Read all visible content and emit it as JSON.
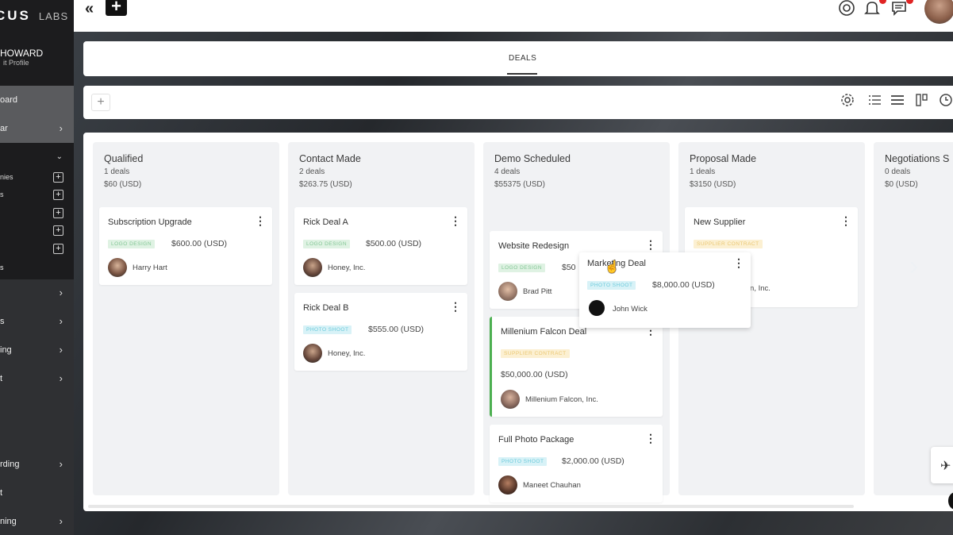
{
  "brand": {
    "logo_text": "CUS",
    "logo_suffix": "LABS"
  },
  "user": {
    "name": "HOWARD",
    "edit_link": "it Profile"
  },
  "sidebar": {
    "items": [
      {
        "label": "oard",
        "chevron": false
      },
      {
        "label": "ar",
        "chevron": true
      },
      {
        "label": "",
        "chevron": true
      },
      {
        "label": "s",
        "chevron": false
      },
      {
        "label": "",
        "chevron": true
      },
      {
        "label": "s",
        "chevron": true
      },
      {
        "label": "ing",
        "chevron": true
      },
      {
        "label": "t",
        "chevron": true
      },
      {
        "label": "rding",
        "chevron": true
      },
      {
        "label": "t",
        "chevron": false
      },
      {
        "label": "ning",
        "chevron": true
      }
    ],
    "subitems": [
      "nies",
      "s",
      "",
      "",
      ""
    ]
  },
  "topbar": {
    "collapse_glyph": "«",
    "add_glyph": "+",
    "icons": [
      "support-icon",
      "bell-icon",
      "chat-icon"
    ]
  },
  "tabs": [
    {
      "label": "DEALS",
      "active": true
    }
  ],
  "toolbar": {
    "add_glyph": "+"
  },
  "columns": [
    {
      "title": "Qualified",
      "count": "1 deals",
      "total": "$60 (USD)",
      "cards": [
        {
          "title": "Subscription Upgrade",
          "tag": "LOGO DESIGN",
          "tag_type": "logo",
          "amount": "$600.00 (USD)",
          "company": "Harry Hart"
        }
      ]
    },
    {
      "title": "Contact Made",
      "count": "2 deals",
      "total": "$263.75 (USD)",
      "cards": [
        {
          "title": "Rick Deal A",
          "tag": "LOGO DESIGN",
          "tag_type": "logo",
          "amount": "$500.00 (USD)",
          "company": "Honey, Inc."
        },
        {
          "title": "Rick Deal B",
          "tag": "PHOTO SHOOT",
          "tag_type": "photo",
          "amount": "$555.00 (USD)",
          "company": "Honey, Inc."
        }
      ]
    },
    {
      "title": "Demo Scheduled",
      "count": "4 deals",
      "total": "$55375 (USD)",
      "cards": [
        {
          "title": "Website Redesign",
          "tag": "LOGO DESIGN",
          "tag_type": "logo",
          "amount": "$50",
          "company": "Brad Pitt"
        },
        {
          "title": "Millenium Falcon Deal",
          "tag": "SUPPLIER CONTRACT",
          "tag_type": "supplier",
          "amount": "$50,000.00 (USD)",
          "company": "Millenium Falcon, Inc."
        },
        {
          "title": "Full Photo Package",
          "tag": "PHOTO SHOOT",
          "tag_type": "photo",
          "amount": "$2,000.00 (USD)",
          "company": "Maneet Chauhan"
        }
      ]
    },
    {
      "title": "Proposal Made",
      "count": "1 deals",
      "total": "$3150 (USD)",
      "cards": [
        {
          "title": "New Supplier",
          "tag": "SUPPLIER CONTRACT",
          "tag_type": "supplier",
          "amount": "D)",
          "company": "tion, Inc."
        }
      ]
    },
    {
      "title": "Negotiations S",
      "count": "0 deals",
      "total": "$0 (USD)",
      "cards": []
    }
  ],
  "dragging_card": {
    "title": "Marketing Deal",
    "tag": "PHOTO SHOOT",
    "tag_type": "photo",
    "amount": "$8,000.00 (USD)",
    "company": "John Wick"
  },
  "menu_glyph": "⋮"
}
